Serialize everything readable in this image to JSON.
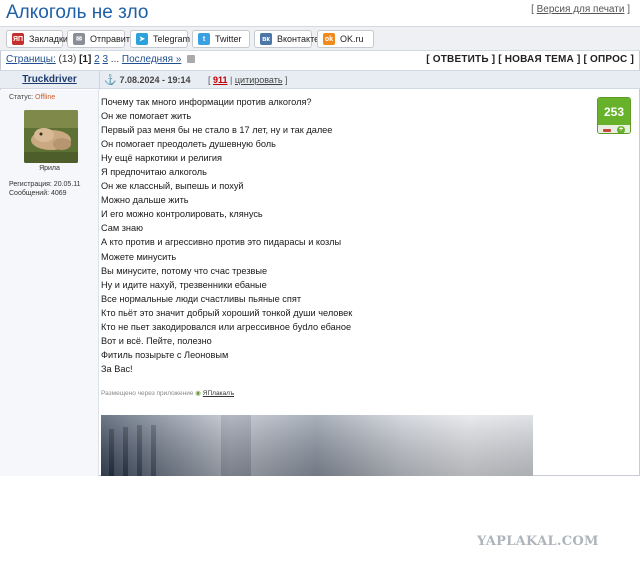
{
  "topic": {
    "title": "Алкоголь не зло",
    "print_label": "Версия для печати"
  },
  "share_buttons": [
    {
      "label": "Закладки",
      "icon": "yaplakal-bookmark-icon",
      "color": "#c4302b",
      "icon_text": "ЯП"
    },
    {
      "label": "Отправить",
      "icon": "envelope-icon",
      "color": "#8a8f96",
      "icon_text": "✉"
    },
    {
      "label": "Telegram",
      "icon": "telegram-icon",
      "color": "#2aa3dd",
      "icon_text": "➤"
    },
    {
      "label": "Twitter",
      "icon": "twitter-icon",
      "color": "#3aa0e4",
      "icon_text": "t"
    },
    {
      "label": "Вконтакте",
      "icon": "vk-icon",
      "color": "#4b76a8",
      "icon_text": "вк"
    },
    {
      "label": "OK.ru",
      "icon": "odnoklassniki-icon",
      "color": "#f08a1c",
      "icon_text": "ok"
    }
  ],
  "pagination": {
    "label": "Страницы:",
    "total": "(13)",
    "current": "[1]",
    "page2": "2",
    "page3": "3",
    "ellipsis": "...",
    "last": "Последняя »"
  },
  "actions": {
    "reply": "ОТВЕТИТЬ",
    "new_topic": "НОВАЯ ТЕМА",
    "poll": "ОПРОС"
  },
  "post": {
    "author": "Truckdriver",
    "status_label": "Статус:",
    "status_value": "Offline",
    "avatar_caption": "Ярила",
    "registration": "Регистрация: 20.05.11",
    "messages": "Сообщений: 4069",
    "date": "7.08.2024 - 19:14",
    "reply_count": "911",
    "quote_label": "цитировать",
    "rating": "253",
    "lines": [
      "Почему так много информации против алкоголя?",
      "Он же помогает жить",
      "Первый раз меня бы не стало в 17 лет, ну и так далее",
      "Он помогает преодолеть душевную боль",
      "Ну ещё наркотики и религия",
      "Я предпочитаю алкоголь",
      "Он же классный, выпешь и похуй",
      "Можно дальше жить",
      "И его можно контролировать, клянусь",
      "Сам знаю",
      "А кто против и агрессивно против это пидарасы и козлы",
      "Можете минусить",
      "Вы минусите, потому что счас трезвые",
      "Ну и идите нахуй, трезвенники ебаные",
      "Все нормальные люди счастливы пьяные спят",
      "Кто пьёт это значит добрый хороший тонкой души человек",
      "Кто не пьет закодировался или агрессивное бydло ебаное",
      "Вот и всё. Пейте, полезно",
      "Фитиль позырьте с Леоновым",
      "За Вас!"
    ],
    "via_label": "Размещено через приложение",
    "via_app": "ЯПлакалъ"
  },
  "watermark": "YAPLAKAL.COM",
  "colors": {
    "title": "#1f5fa6",
    "rating_green": "#67b22a",
    "offline": "#d05a2a",
    "reply_count": "#c00000"
  }
}
